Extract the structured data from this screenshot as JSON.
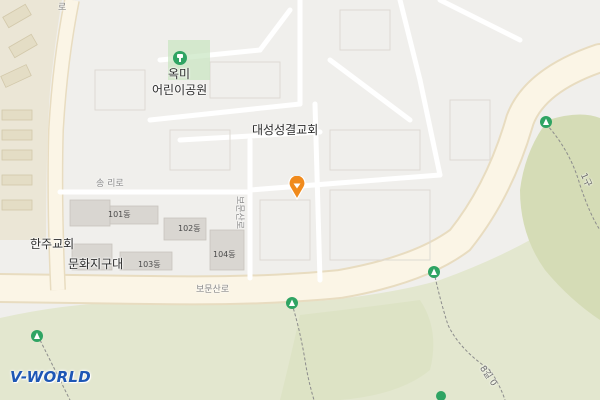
{
  "map": {
    "brand": "V-WORLD",
    "poi_labels": [
      {
        "id": "okmi-park-line1",
        "text": "옥미"
      },
      {
        "id": "okmi-park-line2",
        "text": "어린이공원"
      },
      {
        "id": "daesung-church",
        "text": "대성성결교회"
      },
      {
        "id": "hanju-church",
        "text": "한주교회"
      },
      {
        "id": "cultural-district",
        "text": "문화지구대"
      }
    ],
    "road_labels": [
      {
        "id": "songri-ro",
        "text": "송 리로"
      },
      {
        "id": "bomun-sanro",
        "text": "보문산로"
      },
      {
        "id": "bomun-sanro-vertical",
        "text": "보문산로"
      },
      {
        "id": "top-road",
        "text": "로"
      }
    ],
    "building_labels": [
      {
        "id": "bldg-101",
        "text": "101동"
      },
      {
        "id": "bldg-102",
        "text": "102동"
      },
      {
        "id": "bldg-103",
        "text": "103동"
      },
      {
        "id": "bldg-104",
        "text": "104동"
      }
    ],
    "trail_labels": [
      {
        "id": "trail-right",
        "text": "1구"
      },
      {
        "id": "trail-bottom",
        "text": "8길 0"
      }
    ],
    "colors": {
      "background": "#f0efec",
      "road": "#fbf5e6",
      "road_edge": "#e8dcc0",
      "forest": "#e3e7cf",
      "forest_dark": "#d5dcb6",
      "building": "#d9d6d1",
      "building_outline": "#c8c4bd",
      "block_line": "#ffffff",
      "park_green": "#c8e6c0",
      "marker": "#f08a1c",
      "brand": "#1e57b5",
      "trail_icon": "#2fa463"
    }
  }
}
